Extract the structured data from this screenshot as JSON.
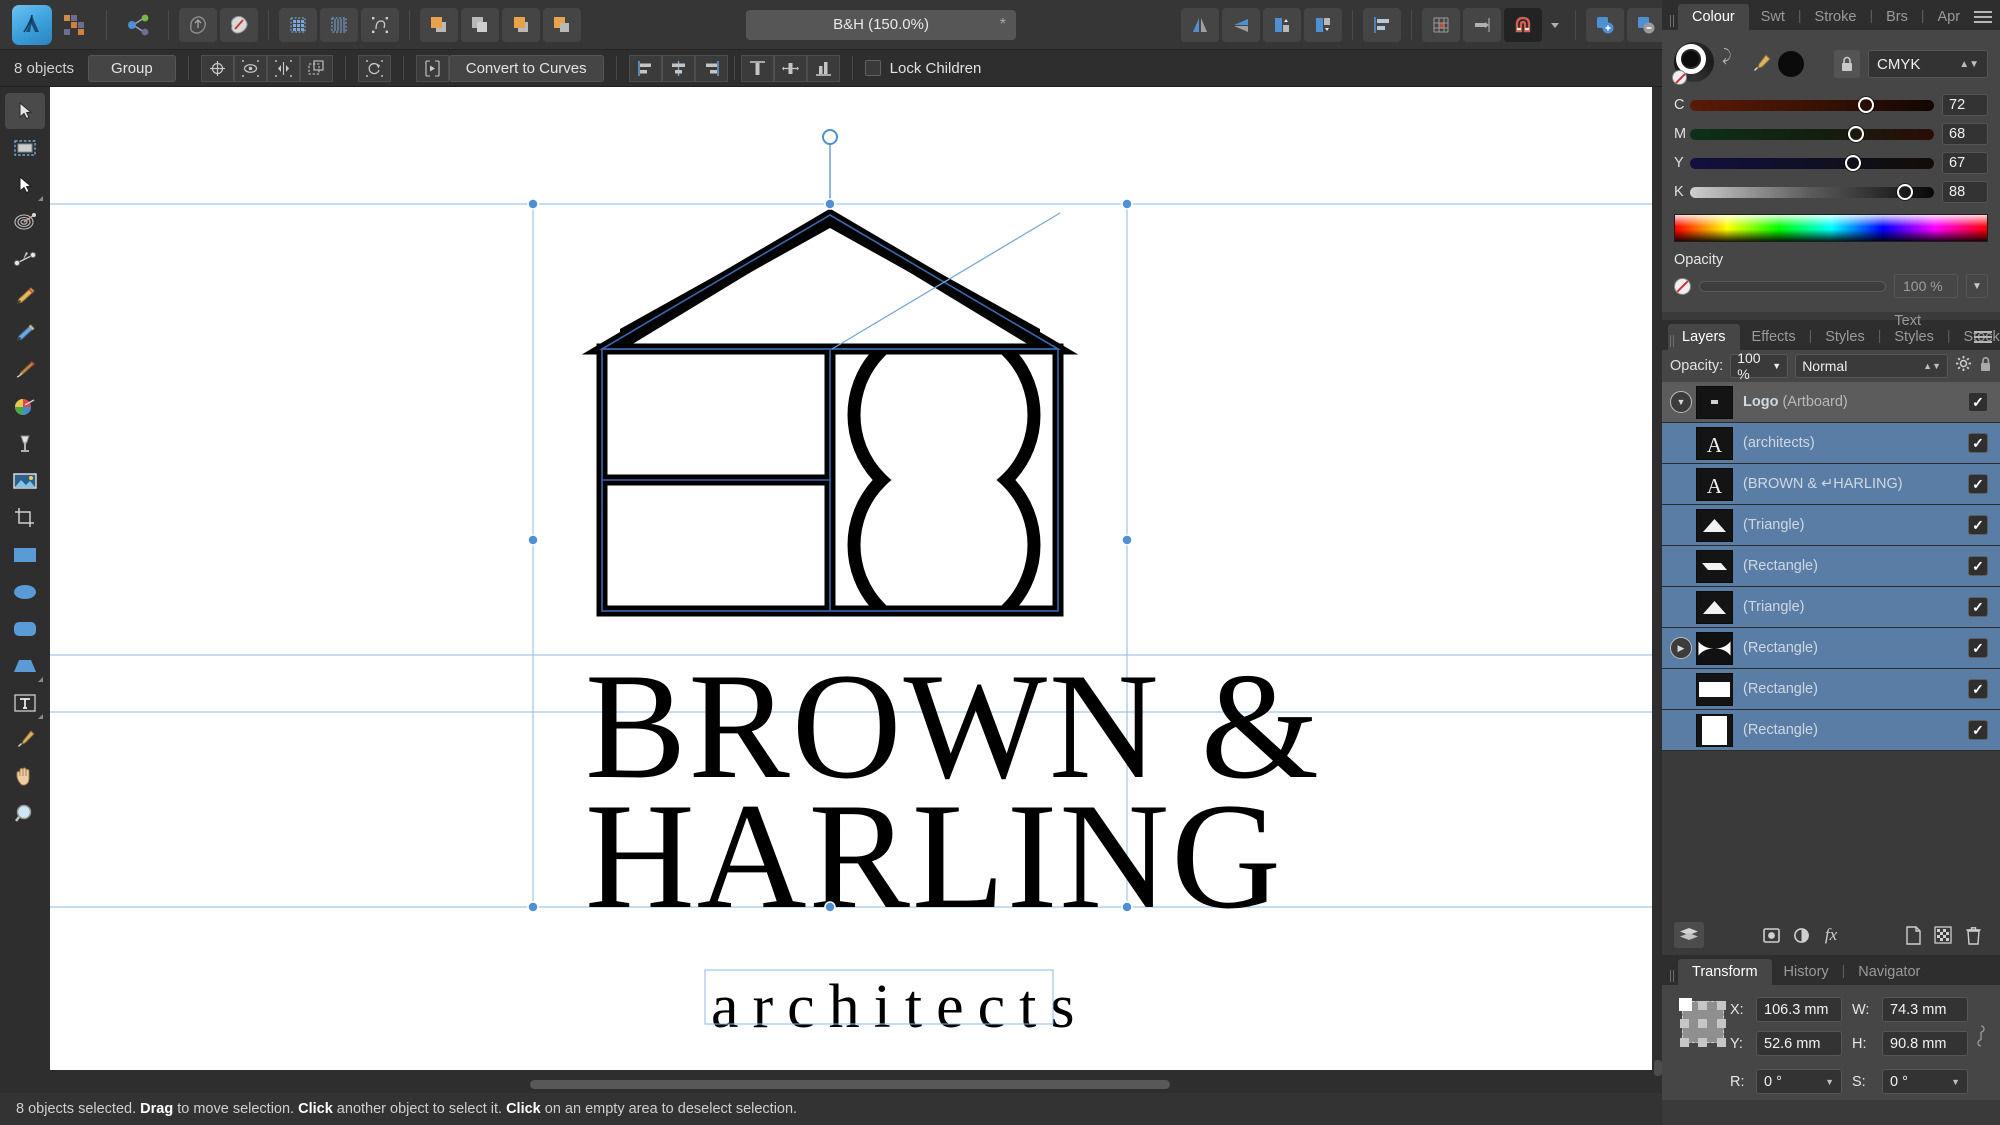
{
  "app": {
    "name": "Affinity Designer",
    "document_title": "B&H (150.0%)",
    "modified_marker": "*"
  },
  "toolbar": {
    "icons": [
      {
        "name": "app-logo-icon",
        "label": "Affinity Designer"
      },
      {
        "name": "persona-pixel-icon",
        "label": "Pixel Persona"
      },
      {
        "name": "persona-export-icon",
        "label": "Export Persona"
      },
      {
        "name": "new-document-icon",
        "label": "New"
      },
      {
        "name": "open-document-icon",
        "label": "Open"
      },
      {
        "name": "snapping-grid-icon",
        "label": "Show Grid"
      },
      {
        "name": "pixel-grid-icon",
        "label": "Pixel Grid"
      },
      {
        "name": "outline-view-icon",
        "label": "Outline View"
      },
      {
        "name": "order-forward-icon",
        "label": "Move Forward"
      },
      {
        "name": "order-back-icon",
        "label": "Move Back"
      },
      {
        "name": "order-front-icon",
        "label": "Move to Front"
      },
      {
        "name": "order-behind-icon",
        "label": "Move to Behind"
      },
      {
        "name": "flip-horizontal-icon",
        "label": "Flip Horizontal"
      },
      {
        "name": "flip-vertical-icon",
        "label": "Flip Vertical"
      },
      {
        "name": "rotate-left-icon",
        "label": "Rotate Left"
      },
      {
        "name": "rotate-right-icon",
        "label": "Rotate Right"
      },
      {
        "name": "align-left-icon",
        "label": "Align"
      },
      {
        "name": "grid-settings-icon",
        "label": "Grid and Axis"
      },
      {
        "name": "snapping-icon",
        "label": "Snapping"
      },
      {
        "name": "magnet-icon",
        "label": "Enable Snapping"
      },
      {
        "name": "snapping-dropdown-icon",
        "label": "Snapping Options"
      },
      {
        "name": "boolean-add-icon",
        "label": "Add"
      },
      {
        "name": "boolean-subtract-icon",
        "label": "Subtract"
      },
      {
        "name": "boolean-intersect-icon",
        "label": "Intersect"
      },
      {
        "name": "boolean-divide-icon",
        "label": "Divide"
      },
      {
        "name": "boolean-combine-icon",
        "label": "Combine"
      },
      {
        "name": "geometry-union-icon",
        "label": "Union"
      },
      {
        "name": "geometry-front-icon",
        "label": "Front"
      },
      {
        "name": "geometry-split-icon",
        "label": "Split"
      },
      {
        "name": "account-icon",
        "label": "Account"
      }
    ]
  },
  "context_bar": {
    "object_count": "8 objects",
    "group_label": "Group",
    "convert_label": "Convert to Curves",
    "lock_children_label": "Lock Children",
    "lock_children_checked": false,
    "icons": [
      {
        "name": "set-anchor-icon"
      },
      {
        "name": "show-hide-icon"
      },
      {
        "name": "mirror-icon"
      },
      {
        "name": "duplicate-icon"
      },
      {
        "name": "reset-rotation-icon"
      },
      {
        "name": "expand-stroke-icon"
      },
      {
        "name": "align-left-icon"
      },
      {
        "name": "align-center-horizontal-icon"
      },
      {
        "name": "align-right-icon"
      },
      {
        "name": "align-top-icon"
      },
      {
        "name": "align-middle-vertical-icon"
      },
      {
        "name": "align-bottom-icon"
      }
    ]
  },
  "tools": [
    {
      "name": "move-tool",
      "label": "Move Tool",
      "active": true,
      "has_flyout": false
    },
    {
      "name": "artboard-tool",
      "label": "Artboard Tool",
      "active": false,
      "has_flyout": false
    },
    {
      "name": "node-tool",
      "label": "Node Tool",
      "active": false,
      "has_flyout": true
    },
    {
      "name": "corner-tool",
      "label": "Corner Tool",
      "active": false,
      "has_flyout": false
    },
    {
      "name": "pen-tool",
      "label": "Pen Tool",
      "active": false,
      "has_flyout": false
    },
    {
      "name": "fountain-pen-tool",
      "label": "Pencil Tool",
      "active": false,
      "has_flyout": false
    },
    {
      "name": "pencil-tool",
      "label": "Pencil",
      "active": false,
      "has_flyout": false
    },
    {
      "name": "paintbrush-tool",
      "label": "Vector Brush Tool",
      "active": false,
      "has_flyout": false
    },
    {
      "name": "colour-picker-palette-tool",
      "label": "Fill Tool",
      "active": false,
      "has_flyout": false
    },
    {
      "name": "transparency-tool",
      "label": "Transparency Tool",
      "active": false,
      "has_flyout": false
    },
    {
      "name": "place-image-tool",
      "label": "Place Image Tool",
      "active": false,
      "has_flyout": false
    },
    {
      "name": "crop-tool",
      "label": "Crop Tool",
      "active": false,
      "has_flyout": false
    },
    {
      "name": "rectangle-tool",
      "label": "Rectangle Tool",
      "active": false,
      "has_flyout": false
    },
    {
      "name": "ellipse-tool",
      "label": "Ellipse Tool",
      "active": false,
      "has_flyout": false
    },
    {
      "name": "rounded-rectangle-tool",
      "label": "Rounded Rectangle Tool",
      "active": false,
      "has_flyout": false
    },
    {
      "name": "trapezoid-tool",
      "label": "Trapezoid Tool",
      "active": false,
      "has_flyout": true
    },
    {
      "name": "artistic-text-tool",
      "label": "Frame Text Tool",
      "active": false,
      "has_flyout": true
    },
    {
      "name": "colour-picker-tool",
      "label": "Colour Picker Tool",
      "active": false,
      "has_flyout": false
    },
    {
      "name": "view-pan-tool",
      "label": "View Tool",
      "active": false,
      "has_flyout": false
    },
    {
      "name": "zoom-tool",
      "label": "Zoom Tool",
      "active": false,
      "has_flyout": false
    }
  ],
  "canvas": {
    "logo": {
      "brand_line1": "BROWN &",
      "brand_line2": "HARLING",
      "tagline": "architects"
    }
  },
  "colour_panel": {
    "tabs": [
      {
        "label": "Colour",
        "active": true
      },
      {
        "label": "Swt",
        "active": false
      },
      {
        "label": "Stroke",
        "active": false
      },
      {
        "label": "Brs",
        "active": false
      },
      {
        "label": "Apr",
        "active": false
      }
    ],
    "model": "CMYK",
    "locked": true,
    "channels": [
      {
        "label": "C",
        "value": "72",
        "pct": 72
      },
      {
        "label": "M",
        "value": "68",
        "pct": 68
      },
      {
        "label": "Y",
        "value": "67",
        "pct": 67
      },
      {
        "label": "K",
        "value": "88",
        "pct": 88
      }
    ],
    "opacity_label": "Opacity",
    "opacity_value": "100 %"
  },
  "layers_panel": {
    "tabs": [
      {
        "label": "Layers",
        "active": true
      },
      {
        "label": "Effects",
        "active": false
      },
      {
        "label": "Styles",
        "active": false
      },
      {
        "label": "Text Styles",
        "active": false
      },
      {
        "label": "Stock",
        "active": false
      }
    ],
    "opacity_label": "Opacity:",
    "opacity_value": "100 %",
    "blend_mode": "Normal",
    "rows": [
      {
        "name": "Logo",
        "suffix": " (Artboard)",
        "type": "artboard",
        "selected": false,
        "visible": true,
        "expanded": true,
        "thumb": "artboard",
        "has_disclosure": true
      },
      {
        "name": "(architects)",
        "suffix": "",
        "type": "text",
        "selected": true,
        "visible": true,
        "expanded": false,
        "thumb": "text",
        "has_disclosure": false
      },
      {
        "name": "(BROWN & ↵HARLING)",
        "suffix": "",
        "type": "text",
        "selected": true,
        "visible": true,
        "expanded": false,
        "thumb": "text",
        "has_disclosure": false
      },
      {
        "name": "(Triangle)",
        "suffix": "",
        "type": "shape",
        "selected": true,
        "visible": true,
        "expanded": false,
        "thumb": "triangle",
        "has_disclosure": false
      },
      {
        "name": "(Rectangle)",
        "suffix": "",
        "type": "shape",
        "selected": true,
        "visible": true,
        "expanded": false,
        "thumb": "parallelogram",
        "has_disclosure": false
      },
      {
        "name": "(Triangle)",
        "suffix": "",
        "type": "shape",
        "selected": true,
        "visible": true,
        "expanded": false,
        "thumb": "triangle",
        "has_disclosure": false
      },
      {
        "name": "(Rectangle)",
        "suffix": "",
        "type": "shape",
        "selected": true,
        "visible": true,
        "expanded": false,
        "thumb": "circles",
        "has_disclosure": true
      },
      {
        "name": "(Rectangle)",
        "suffix": "",
        "type": "shape",
        "selected": true,
        "visible": true,
        "expanded": false,
        "thumb": "rect-wide",
        "has_disclosure": false
      },
      {
        "name": "(Rectangle)",
        "suffix": "",
        "type": "shape",
        "selected": true,
        "visible": true,
        "expanded": false,
        "thumb": "rect-tall",
        "has_disclosure": false
      }
    ],
    "bottom_icons": [
      {
        "name": "layer-stack-icon"
      },
      {
        "name": "mask-layer-icon"
      },
      {
        "name": "adjustment-layer-icon"
      },
      {
        "name": "layer-effects-icon"
      },
      {
        "name": "add-layer-icon"
      },
      {
        "name": "add-pixel-layer-icon"
      },
      {
        "name": "delete-layer-icon"
      }
    ]
  },
  "transform_panel": {
    "tabs": [
      {
        "label": "Transform",
        "active": true
      },
      {
        "label": "History",
        "active": false
      },
      {
        "label": "Navigator",
        "active": false
      }
    ],
    "fields": [
      {
        "label": "X:",
        "value": "106.3 mm"
      },
      {
        "label": "W:",
        "value": "74.3 mm"
      },
      {
        "label": "Y:",
        "value": "52.6 mm"
      },
      {
        "label": "H:",
        "value": "90.8 mm"
      },
      {
        "label": "R:",
        "value": "0 °"
      },
      {
        "label": "S:",
        "value": "0 °"
      }
    ]
  },
  "status_bar": {
    "prefix": "8 objects selected. ",
    "b1": "Drag",
    "mid1": " to move selection. ",
    "b2": "Click",
    "mid2": " another object to select it. ",
    "b3": "Click",
    "suffix": " on an empty area to deselect selection."
  },
  "colors": {
    "accent_blue": "#4f8fd4",
    "selection_blue": "#5a7da6",
    "panel_bg": "#464646",
    "chrome_bg": "#2e2e2e",
    "toolbar_bg": "#363636"
  }
}
